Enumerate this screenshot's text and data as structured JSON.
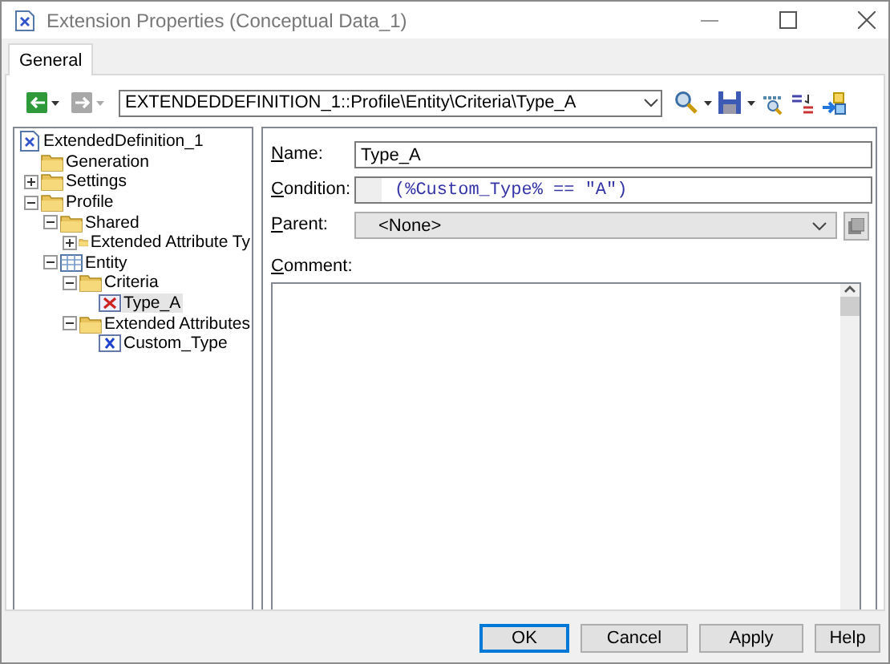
{
  "window": {
    "title": "Extension Properties (Conceptual Data_1)"
  },
  "tabs": [
    {
      "label": "General",
      "selected": true
    }
  ],
  "toolbar": {
    "nav_buttons": [
      {
        "kind": "back",
        "disabled": false
      },
      {
        "kind": "forward",
        "disabled": true
      }
    ],
    "path": "EXTENDEDDEFINITION_1::Profile\\Entity\\Criteria\\Type_A"
  },
  "tree": [
    {
      "label": "ExtendedDefinition_1",
      "kind": "definition",
      "selected": false,
      "children": [
        {
          "label": "Generation",
          "kind": "folder",
          "selected": false
        },
        {
          "label": "Settings",
          "kind": "folder",
          "expanded": false,
          "selected": false
        },
        {
          "label": "Profile",
          "kind": "folder",
          "expanded": true,
          "selected": false,
          "children": [
            {
              "label": "Shared",
              "kind": "folder",
              "expanded": true,
              "selected": false,
              "children": [
                {
                  "label": "Extended Attribute Ty",
                  "kind": "folder",
                  "expanded": false,
                  "selected": false
                }
              ]
            },
            {
              "label": "Entity",
              "kind": "table",
              "expanded": true,
              "selected": false,
              "children": [
                {
                  "label": "Criteria",
                  "kind": "folder",
                  "expanded": true,
                  "selected": false,
                  "children": [
                    {
                      "label": "Type_A",
                      "kind": "criterion",
                      "selected": true
                    }
                  ]
                },
                {
                  "label": "Extended Attributes",
                  "kind": "folder",
                  "expanded": true,
                  "selected": false,
                  "children": [
                    {
                      "label": "Custom_Type",
                      "kind": "attribute",
                      "selected": false
                    }
                  ]
                }
              ]
            }
          ]
        }
      ]
    }
  ],
  "form": {
    "name_label": "Name:",
    "name": "Type_A",
    "condition_label": "Condition:",
    "condition": "(%Custom_Type% == \"A\")",
    "parent_label": "Parent:",
    "parent": "<None>",
    "comment_label": "Comment:"
  },
  "buttons": [
    {
      "label": "OK",
      "default": true
    },
    {
      "label": "Cancel",
      "default": false
    },
    {
      "label": "Apply",
      "default": false
    },
    {
      "label": "Help",
      "default": false
    }
  ]
}
